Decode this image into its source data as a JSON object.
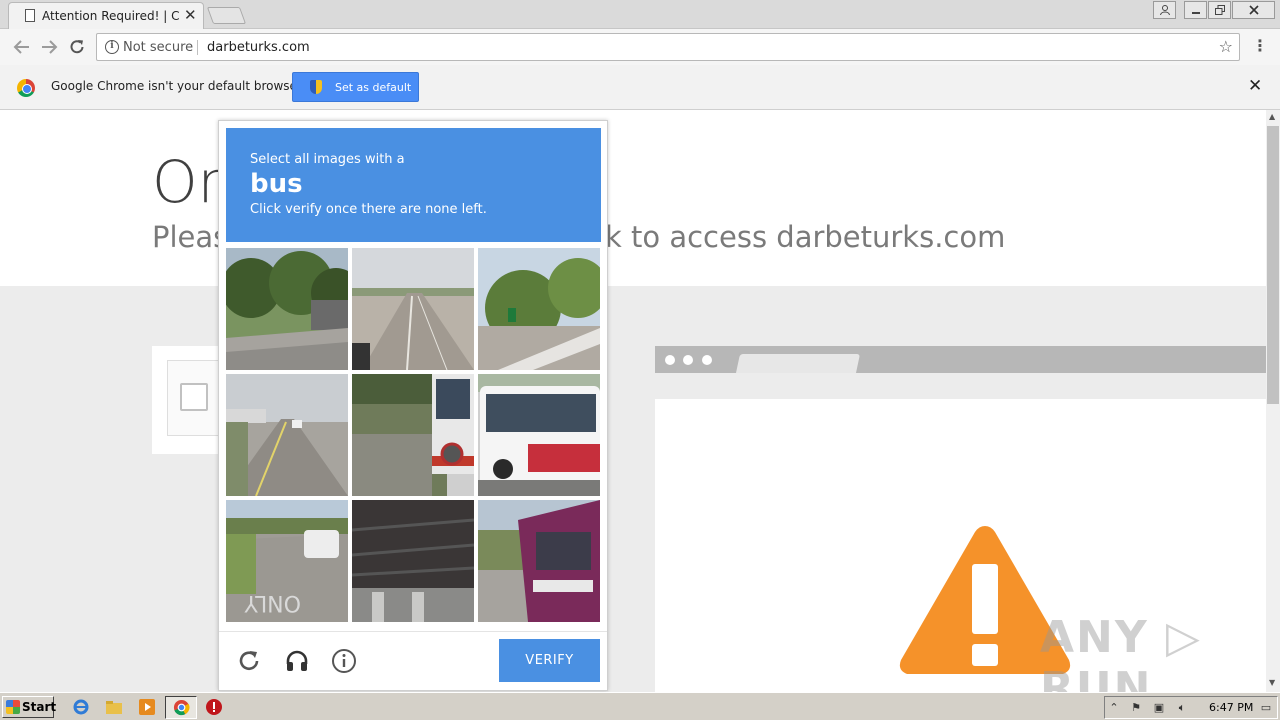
{
  "browser": {
    "tab_title": "Attention Required! | Cloudfl",
    "tab_close": "✕",
    "address": {
      "security_label": "Not secure",
      "url": "darbeturks.com"
    },
    "infobar": {
      "message": "Google Chrome isn't your default browser",
      "button_label": "Set as default",
      "close": "✕"
    }
  },
  "page": {
    "heading_start": "On",
    "subheading_start": "Pleas",
    "subheading_end": "k to access darbeturks.com"
  },
  "captcha": {
    "instruction_line1": "Select all images with a",
    "target_object": "bus",
    "instruction_line3": "Click verify once there are none left.",
    "verify_label": "VERIFY",
    "tiles": [
      "street-with-trees",
      "empty-highway",
      "overpass-with-trees",
      "highway-under-cloudy-sky",
      "bus-side-with-bicycle",
      "white-city-bus",
      "road-with-white-suv",
      "bridge-underside",
      "purple-bus"
    ]
  },
  "watermark": "ANY ▷ RUN",
  "taskbar": {
    "start_label": "Start",
    "clock": "6:47 PM"
  }
}
